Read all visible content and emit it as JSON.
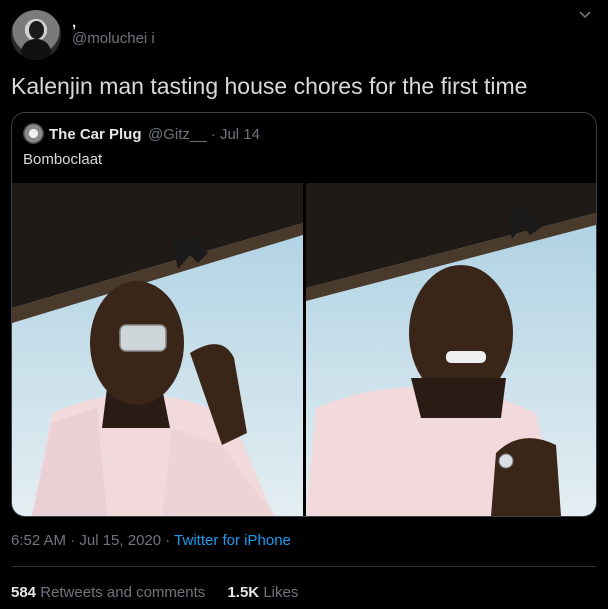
{
  "tweet": {
    "display_name": ",",
    "handle": "@moluchei i",
    "text": "Kalenjin man tasting house chores for the first time",
    "timestamp": "6:52 AM · Jul 15, 2020 · ",
    "source": "Twitter for iPhone",
    "retweets_count": "584",
    "retweets_label": "Retweets and comments",
    "likes_count": "1.5K",
    "likes_label": "Likes"
  },
  "quoted": {
    "name": "The Car Plug",
    "handle": "@Gitz__",
    "separator": "·",
    "date": "Jul 14",
    "text": "Bomboclaat"
  },
  "icons": {
    "menu": "chevron-down-icon"
  },
  "colors": {
    "background": "#000000",
    "link": "#1d9bf0",
    "muted": "#6e767d"
  }
}
